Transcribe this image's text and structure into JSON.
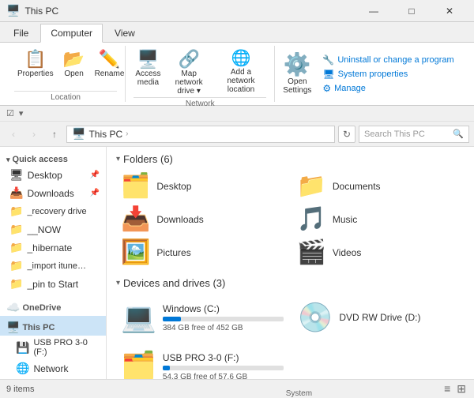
{
  "titleBar": {
    "title": "This PC",
    "icon": "🖥️",
    "controls": {
      "minimize": "—",
      "maximize": "□",
      "close": "✕"
    }
  },
  "ribbonTabs": [
    {
      "id": "file",
      "label": "File",
      "active": false
    },
    {
      "id": "computer",
      "label": "Computer",
      "active": true
    },
    {
      "id": "view",
      "label": "View",
      "active": false
    }
  ],
  "ribbon": {
    "groups": [
      {
        "id": "location",
        "label": "Location",
        "items": [
          {
            "id": "properties",
            "icon": "📋",
            "label": "Properties"
          },
          {
            "id": "open",
            "icon": "📂",
            "label": "Open"
          },
          {
            "id": "rename",
            "icon": "✏️",
            "label": "Rename"
          }
        ]
      },
      {
        "id": "network",
        "label": "Network",
        "items": [
          {
            "id": "access-media",
            "icon": "🖥️",
            "label": "Access\nmedia"
          },
          {
            "id": "map-network",
            "icon": "🔗",
            "label": "Map network\ndrive ▾"
          },
          {
            "id": "add-network",
            "icon": "➕",
            "label": "Add a network\nlocation"
          }
        ]
      },
      {
        "id": "system",
        "label": "System",
        "smallItems": [
          {
            "id": "uninstall",
            "label": "Uninstall or change a program"
          },
          {
            "id": "sys-props",
            "label": "System properties"
          },
          {
            "id": "manage",
            "label": "Manage"
          }
        ],
        "openSettings": {
          "icon": "⚙️",
          "label": "Open\nSettings"
        }
      }
    ]
  },
  "quickAccess": {
    "checkbox": "☑",
    "dropArrow": "▾"
  },
  "navBar": {
    "back": "‹",
    "forward": "›",
    "up": "↑",
    "addressParts": [
      "This PC"
    ],
    "refreshIcon": "↻",
    "searchPlaceholder": "Search This PC",
    "searchIcon": "🔍"
  },
  "sidebar": {
    "sections": [
      {
        "id": "quick-access",
        "label": "Quick access",
        "icon": "⭐",
        "items": [
          {
            "id": "desktop",
            "label": "Desktop",
            "icon": "🖥",
            "pinned": true
          },
          {
            "id": "downloads",
            "label": "Downloads",
            "icon": "📥",
            "pinned": true
          },
          {
            "id": "recovery",
            "label": "_recovery drive",
            "icon": "📁",
            "pinned": false
          },
          {
            "id": "now",
            "label": "__NOW",
            "icon": "📁",
            "pinned": false
          },
          {
            "id": "hibernate",
            "label": "_hibernate",
            "icon": "📁",
            "pinned": false
          },
          {
            "id": "import-itunes",
            "label": "_import itunes groo",
            "icon": "📁",
            "pinned": false
          },
          {
            "id": "pin-start",
            "label": "_pin to Start",
            "icon": "📁",
            "pinned": false
          }
        ]
      },
      {
        "id": "onedrive",
        "label": "OneDrive",
        "icon": "☁️",
        "items": []
      },
      {
        "id": "this-pc",
        "label": "This PC",
        "icon": "🖥️",
        "active": true,
        "items": [
          {
            "id": "usb-pro",
            "label": "USB PRO 3-0 (F:)",
            "icon": "💾"
          },
          {
            "id": "network",
            "label": "Network",
            "icon": "🌐"
          }
        ]
      }
    ]
  },
  "content": {
    "foldersSection": {
      "title": "Folders (6)",
      "folders": [
        {
          "id": "desktop",
          "name": "Desktop",
          "icon": "🗂️",
          "color": "yellow"
        },
        {
          "id": "documents",
          "name": "Documents",
          "icon": "📁",
          "color": "yellow"
        },
        {
          "id": "downloads",
          "name": "Downloads",
          "icon": "📁",
          "color": "orange",
          "hasArrow": true
        },
        {
          "id": "music",
          "name": "Music",
          "icon": "🎵",
          "color": "yellow"
        },
        {
          "id": "pictures",
          "name": "Pictures",
          "icon": "📁",
          "color": "tan"
        },
        {
          "id": "videos",
          "name": "Videos",
          "icon": "📁",
          "color": "film"
        }
      ]
    },
    "devicesSection": {
      "title": "Devices and drives (3)",
      "drives": [
        {
          "id": "windows-c",
          "name": "Windows (C:)",
          "icon": "💻",
          "freeSpace": "384 GB free of 452 GB",
          "fillPercent": 15,
          "warning": false
        },
        {
          "id": "dvd-d",
          "name": "DVD RW Drive (D:)",
          "icon": "💿",
          "freeSpace": "",
          "fillPercent": 0,
          "warning": false
        },
        {
          "id": "usb-f",
          "name": "USB PRO 3-0 (F:)",
          "icon": "🗂️",
          "freeSpace": "54.3 GB free of 57.6 GB",
          "fillPercent": 6,
          "warning": false
        }
      ]
    }
  },
  "statusBar": {
    "itemCount": "9 items",
    "viewIcons": [
      "≡",
      "⊞"
    ]
  }
}
